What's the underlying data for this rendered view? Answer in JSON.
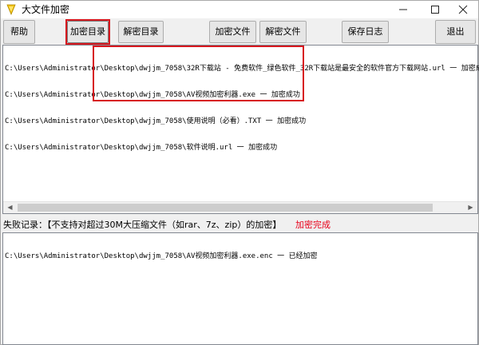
{
  "window": {
    "title": "大文件加密"
  },
  "toolbar": {
    "help": "帮助",
    "encrypt_dir": "加密目录",
    "decrypt_dir": "解密目录",
    "encrypt_file": "加密文件",
    "decrypt_file": "解密文件",
    "save_log": "保存日志",
    "exit": "退出"
  },
  "log": {
    "lines": [
      "C:\\Users\\Administrator\\Desktop\\dwjjm_7058\\32R下载站 - 免费软件_绿色软件_32R下载站是最安全的软件官方下载网站.url 一 加密成功",
      "C:\\Users\\Administrator\\Desktop\\dwjjm_7058\\AV视频加密利器.exe 一 加密成功",
      "C:\\Users\\Administrator\\Desktop\\dwjjm_7058\\使用说明（必看）.TXT 一 加密成功",
      "C:\\Users\\Administrator\\Desktop\\dwjjm_7058\\软件说明.url 一 加密成功"
    ]
  },
  "status": {
    "fail_label": "失败记录：【不支持对超过30M大压缩文件（如rar、7z、zip）的加密】",
    "done_label": "加密完成"
  },
  "fail_log": {
    "lines": [
      "C:\\Users\\Administrator\\Desktop\\dwjjm_7058\\AV视频加密利器.exe.enc 一 已经加密"
    ]
  },
  "colors": {
    "annotation": "#d7171e",
    "status_done": "#e8001a"
  }
}
